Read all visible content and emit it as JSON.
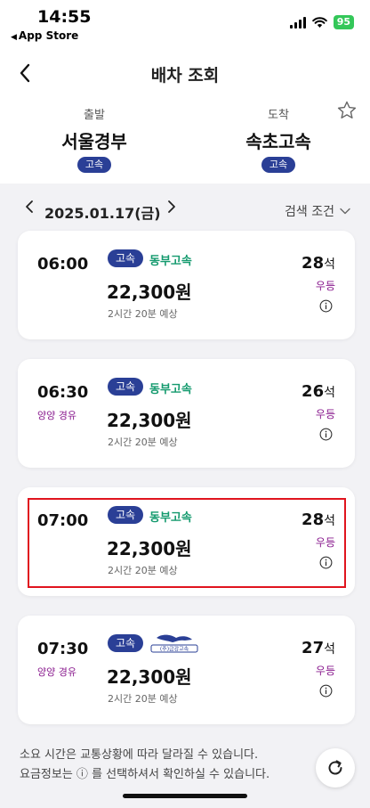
{
  "status_bar": {
    "time": "14:55",
    "back_app": "App Store",
    "battery": "95"
  },
  "header": {
    "title": "배차 조회"
  },
  "route": {
    "departure": {
      "caption": "출발",
      "name": "서울경부",
      "badge": "고속"
    },
    "arrival": {
      "caption": "도착",
      "name": "속초고속",
      "badge": "고속"
    }
  },
  "date_bar": {
    "date": "2025.01.17(금)",
    "filter_label": "검색 조건"
  },
  "buses": [
    {
      "time": "06:00",
      "via": "",
      "badge": "고속",
      "company": "동부고속",
      "price": "22,300원",
      "duration": "2시간 20분 예상",
      "seats": "28",
      "seat_unit": "석",
      "grade": "우등"
    },
    {
      "time": "06:30",
      "via": "양양 경유",
      "badge": "고속",
      "company": "동부고속",
      "price": "22,300원",
      "duration": "2시간 20분 예상",
      "seats": "26",
      "seat_unit": "석",
      "grade": "우등"
    },
    {
      "time": "07:00",
      "via": "",
      "badge": "고속",
      "company": "동부고속",
      "price": "22,300원",
      "duration": "2시간 20분 예상",
      "seats": "28",
      "seat_unit": "석",
      "grade": "우등"
    },
    {
      "time": "07:30",
      "via": "양양 경유",
      "badge": "고속",
      "company": "(주)금강고속",
      "price": "22,300원",
      "duration": "2시간 20분 예상",
      "seats": "27",
      "seat_unit": "석",
      "grade": "우등"
    }
  ],
  "footer": {
    "notice_line1": "소요 시간은 교통상황에 따라 달라질 수 있습니다.",
    "notice_line2": "요금정보는 ⓘ 를 선택하셔서 확인하실 수 있습니다."
  },
  "colors": {
    "badge": "#2a3f96",
    "company": "#149a6e",
    "grade": "#8a1c8f",
    "highlight": "#e0141e",
    "battery": "#34c759"
  },
  "icons": [
    "back-chevron-icon",
    "star-icon",
    "chevron-left-icon",
    "chevron-right-icon",
    "chevron-down-icon",
    "info-icon",
    "refresh-icon",
    "wifi-icon",
    "signal-icon"
  ]
}
